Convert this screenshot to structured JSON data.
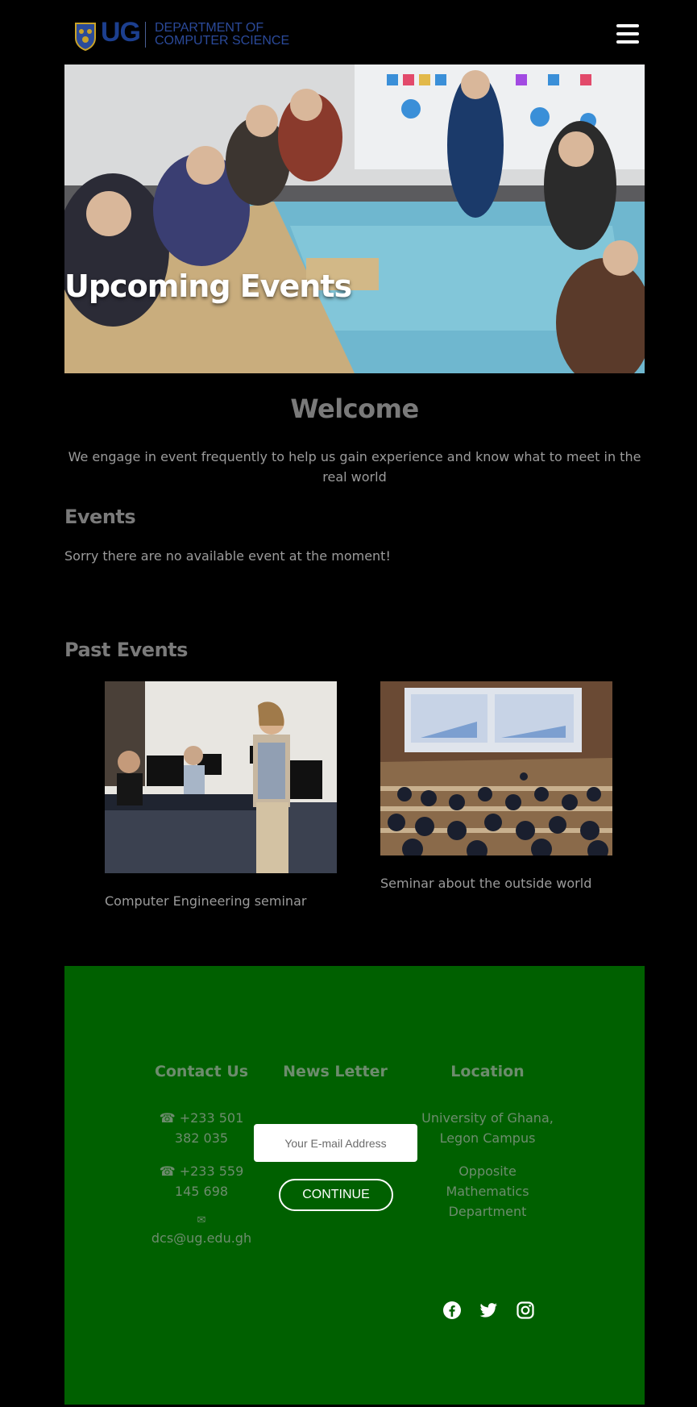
{
  "header": {
    "logo_ug": "UG",
    "logo_dept_line1": "DEPARTMENT OF",
    "logo_dept_line2": "COMPUTER SCIENCE",
    "menu_icon": "hamburger-menu-icon"
  },
  "hero": {
    "title": "Upcoming Events"
  },
  "welcome": {
    "title": "Welcome",
    "text": "We engage in event frequently to help us gain experience and know what to meet in the real world"
  },
  "events": {
    "title": "Events",
    "empty_message": "Sorry there are no available event at the moment!"
  },
  "past_events": {
    "title": "Past Events",
    "items": [
      {
        "caption": "Computer Engineering seminar"
      },
      {
        "caption": "Seminar about the outside world"
      }
    ]
  },
  "footer": {
    "contact": {
      "title": "Contact Us",
      "phone1": "+233 501 382 035",
      "phone2": "+233 559 145 698",
      "email": "dcs@ug.edu.gh"
    },
    "newsletter": {
      "title": "News Letter",
      "placeholder": "Your E-mail Address",
      "button_label": "CONTINUE"
    },
    "location": {
      "title": "Location",
      "line1": "University of Ghana, Legon Campus",
      "line2": "Opposite Mathematics Department"
    },
    "social": [
      "facebook-icon",
      "twitter-icon",
      "instagram-icon"
    ]
  },
  "colors": {
    "background": "#000000",
    "footer_bg": "#006000",
    "logo_blue": "#1c3f8f",
    "muted_text": "#9b9b9b"
  }
}
